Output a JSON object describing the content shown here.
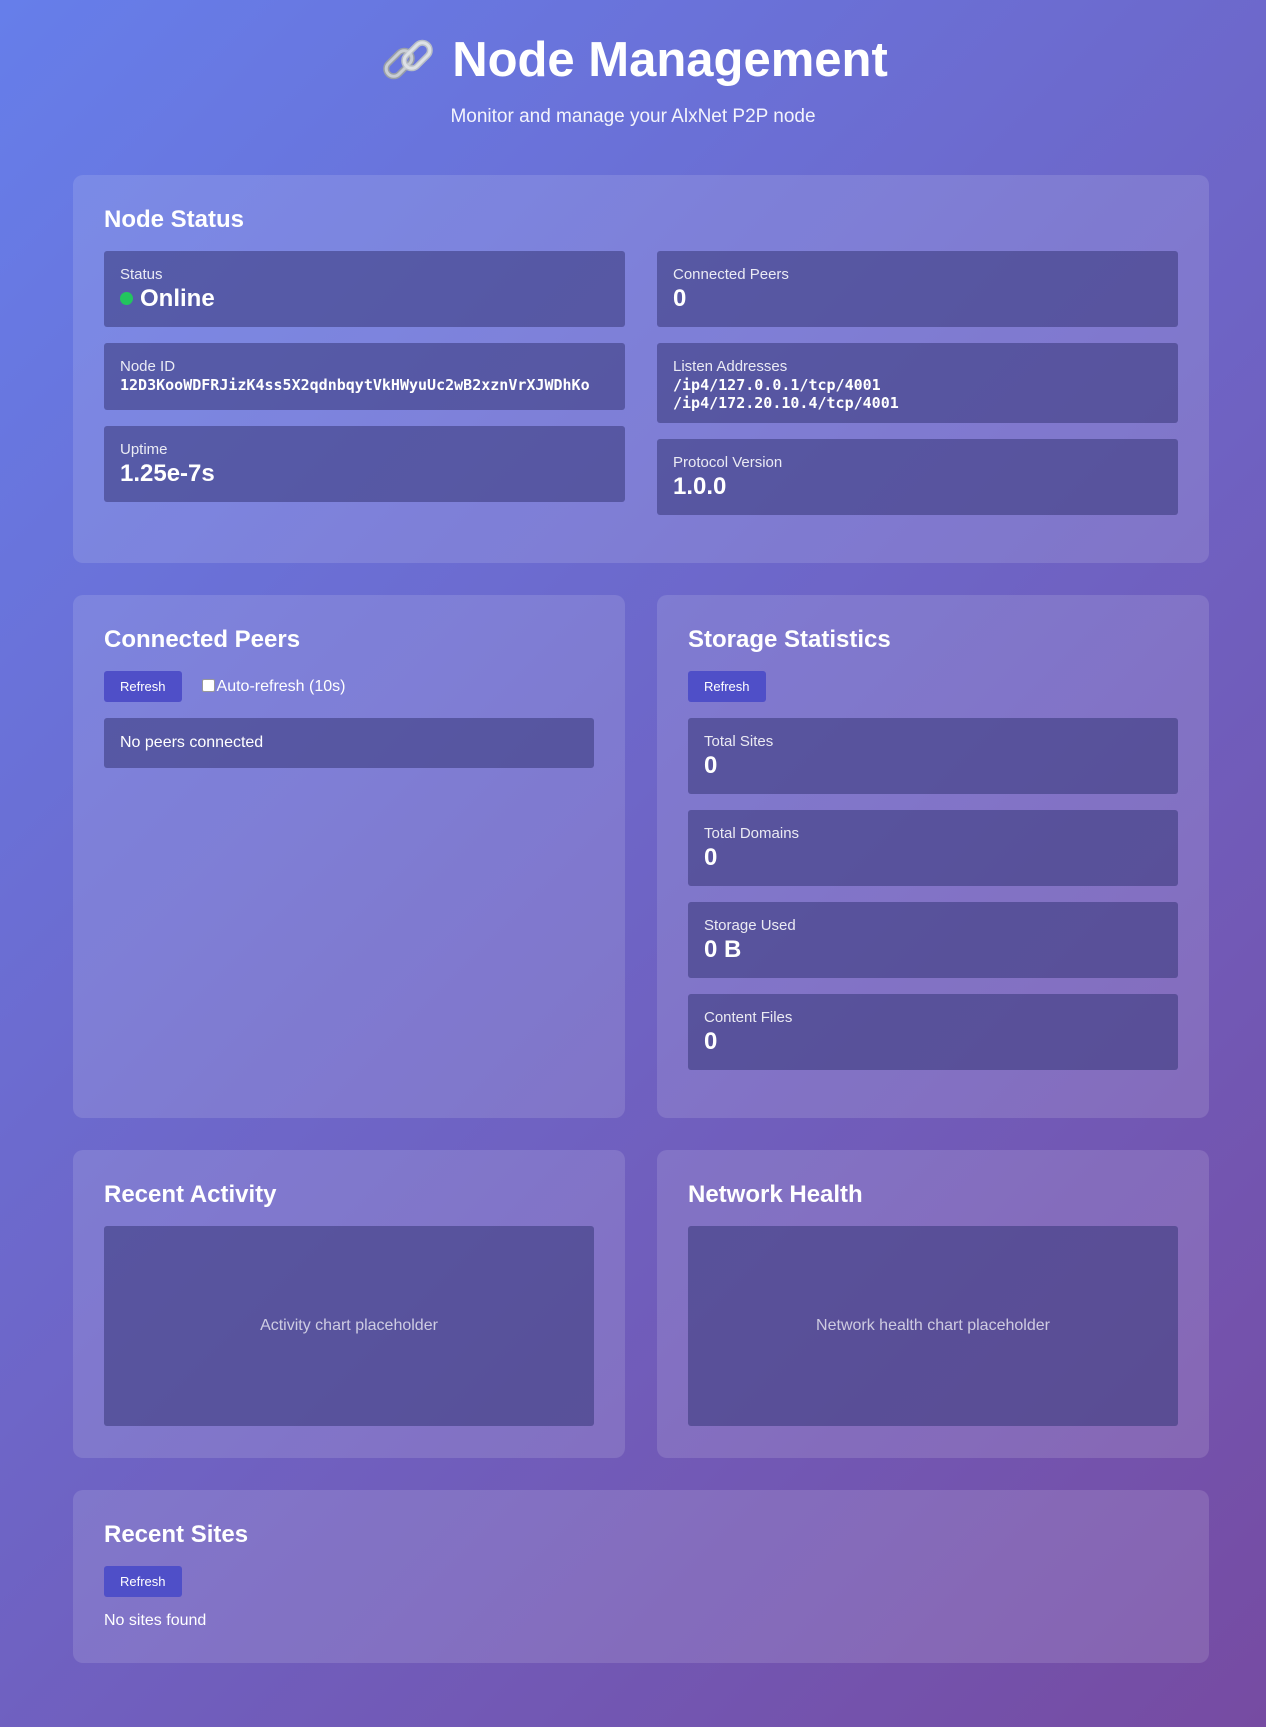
{
  "header": {
    "title": "Node Management",
    "subtitle": "Monitor and manage your AlxNet P2P node"
  },
  "node_status": {
    "title": "Node Status",
    "status_label": "Status",
    "status_value": "Online",
    "node_id_label": "Node ID",
    "node_id_value": "12D3KooWDFRJizK4ss5X2qdnbqytVkHWyuUc2wB2xznVrXJWDhKo",
    "uptime_label": "Uptime",
    "uptime_value": "1.25e-7s",
    "peers_label": "Connected Peers",
    "peers_value": "0",
    "listen_label": "Listen Addresses",
    "listen_addresses": [
      "/ip4/127.0.0.1/tcp/4001",
      "/ip4/172.20.10.4/tcp/4001"
    ],
    "protocol_label": "Protocol Version",
    "protocol_value": "1.0.0"
  },
  "connected_peers": {
    "title": "Connected Peers",
    "refresh_label": "Refresh",
    "auto_refresh_label": "Auto-refresh (10s)",
    "empty_text": "No peers connected"
  },
  "storage": {
    "title": "Storage Statistics",
    "refresh_label": "Refresh",
    "total_sites_label": "Total Sites",
    "total_sites_value": "0",
    "total_domains_label": "Total Domains",
    "total_domains_value": "0",
    "storage_used_label": "Storage Used",
    "storage_used_value": "0 B",
    "content_files_label": "Content Files",
    "content_files_value": "0"
  },
  "activity": {
    "title": "Recent Activity",
    "placeholder": "Activity chart placeholder"
  },
  "network_health": {
    "title": "Network Health",
    "placeholder": "Network health chart placeholder"
  },
  "recent_sites": {
    "title": "Recent Sites",
    "refresh_label": "Refresh",
    "empty_text": "No sites found"
  },
  "colors": {
    "status_online": "#22c55e",
    "button": "#4f4fc8",
    "gradient_start": "#667eea",
    "gradient_end": "#764ba2"
  },
  "icons": {
    "title_icon": "link-icon"
  }
}
